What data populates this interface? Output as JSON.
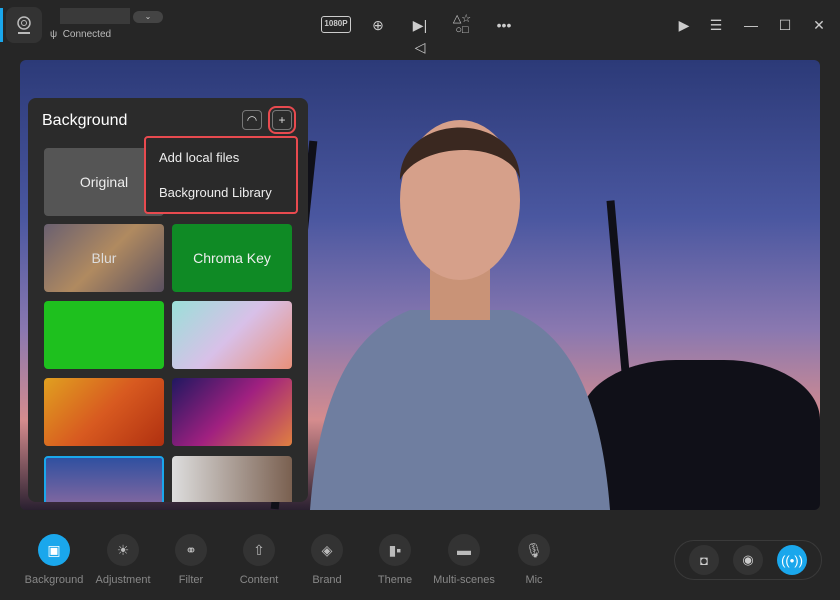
{
  "header": {
    "status": "Connected",
    "dropdown_icon": "chevron-down-icon",
    "resolution": "1080P",
    "icons": [
      "zoom-in-icon",
      "mirror-icon",
      "shapes-icon",
      "more-icon",
      "play-icon",
      "menu-icon",
      "minimize-icon",
      "maximize-icon",
      "close-icon"
    ]
  },
  "panel": {
    "title": "Background",
    "tiles": [
      {
        "label": "Original"
      },
      {
        "label": "Blur"
      },
      {
        "label": "Chroma Key"
      }
    ],
    "menu": [
      "Add local files",
      "Background Library"
    ]
  },
  "toolbar": {
    "items": [
      {
        "label": "Background",
        "icon": "image-icon",
        "active": true
      },
      {
        "label": "Adjustment",
        "icon": "sun-icon"
      },
      {
        "label": "Filter",
        "icon": "filter-icon"
      },
      {
        "label": "Content",
        "icon": "upload-icon"
      },
      {
        "label": "Brand",
        "icon": "tag-icon"
      },
      {
        "label": "Theme",
        "icon": "theme-icon"
      },
      {
        "label": "Multi-scenes",
        "icon": "scenes-icon"
      },
      {
        "label": "Mic",
        "icon": "mic-icon"
      }
    ]
  },
  "actions": [
    "camera-icon",
    "record-icon",
    "live-icon"
  ],
  "colors": {
    "accent": "#1aa7ec",
    "highlight": "#e84a4f"
  }
}
